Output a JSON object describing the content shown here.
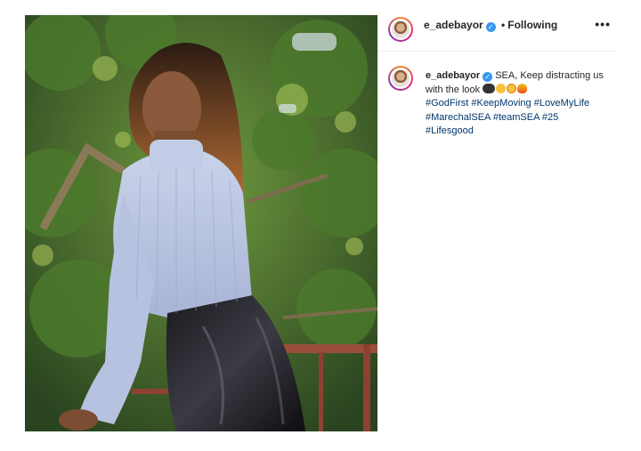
{
  "post": {
    "username": "e_adebayor",
    "separator": "•",
    "follow_status": "Following",
    "more_label": "•••",
    "caption_text": "SEA, Keep distracting us with the look",
    "emojis": [
      "eyes-emoji",
      "grin-emoji",
      "kiss-emoji",
      "fire-emoji"
    ],
    "hashtags": [
      "#GodFirst",
      "#KeepMoving",
      "#LoveMyLife",
      "#MarechalSEA",
      "#teamSEA",
      "#25",
      "#Lifesgood"
    ]
  },
  "colors": {
    "link": "#00376b",
    "verified": "#3897f0",
    "border": "#efefef"
  }
}
